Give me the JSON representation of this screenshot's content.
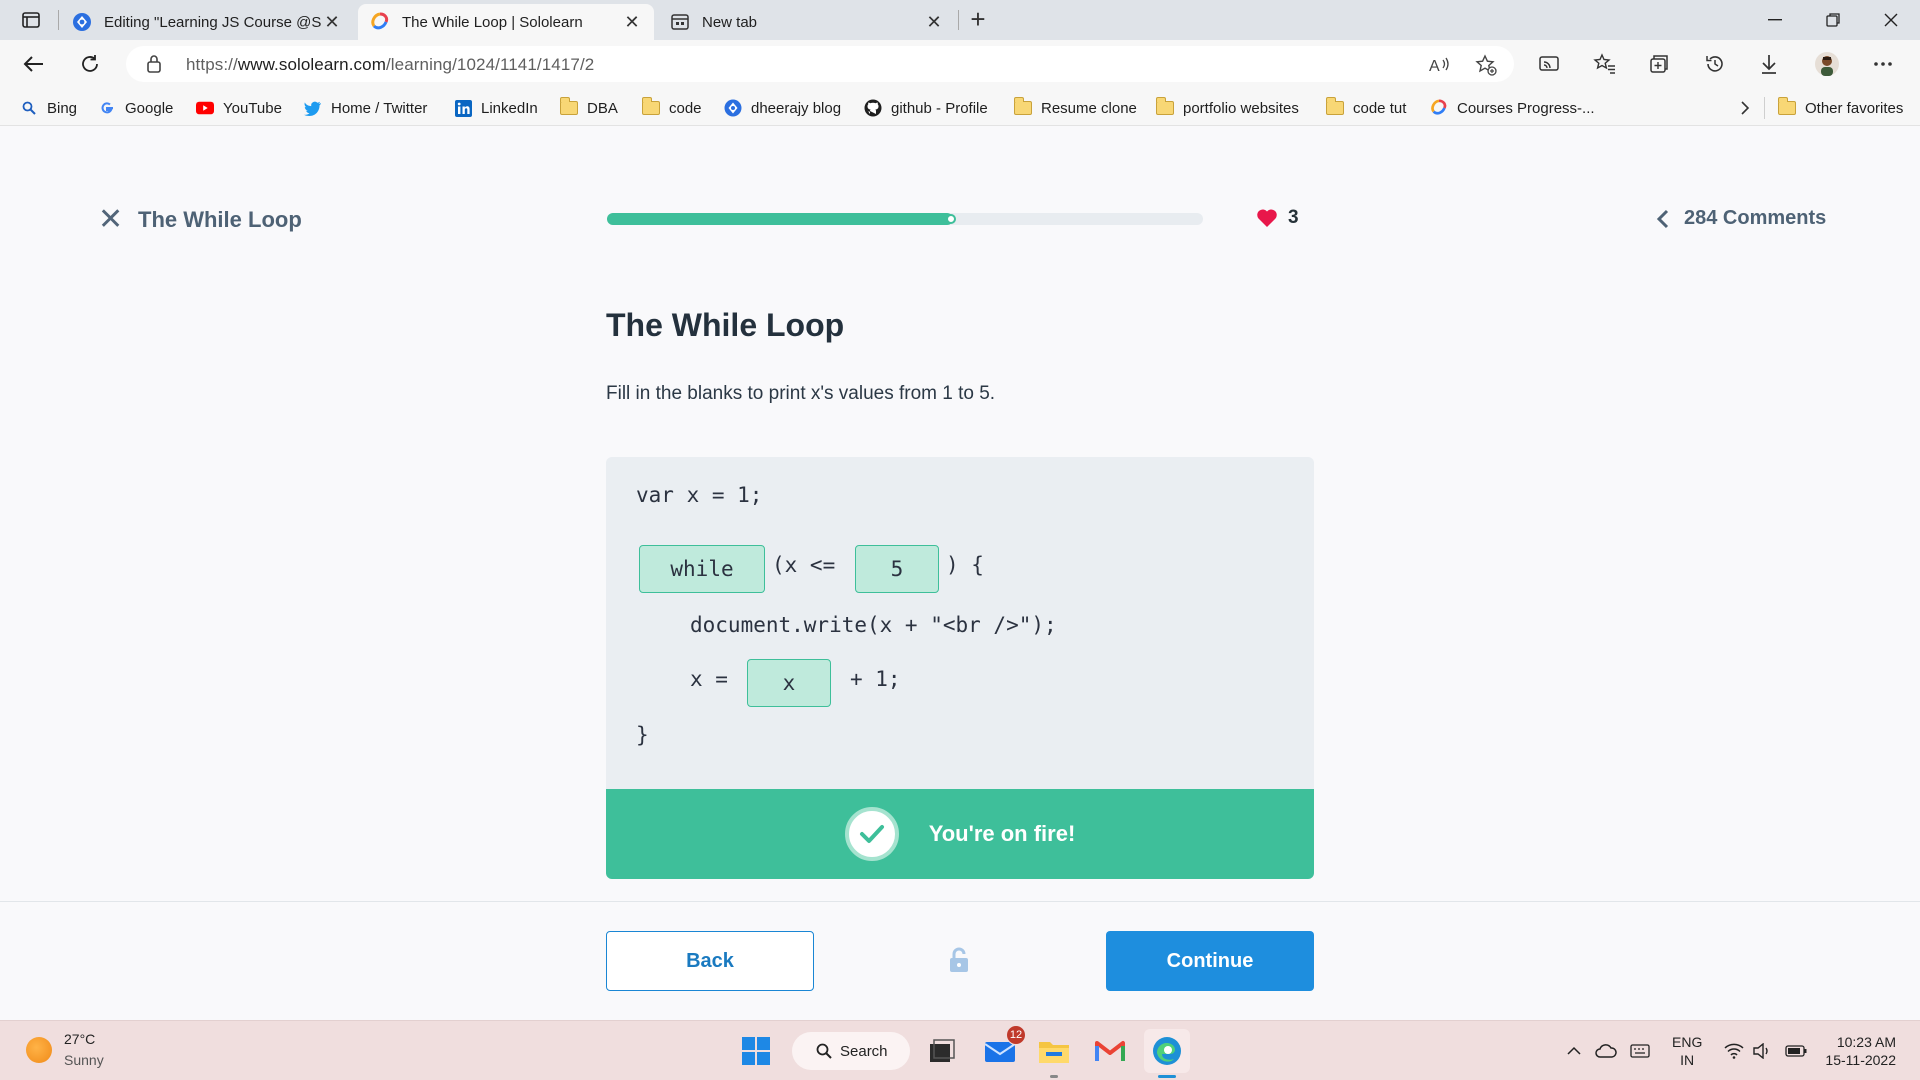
{
  "browser": {
    "tabs": [
      {
        "title": "Editing \"Learning JS Course @Sc",
        "active": false
      },
      {
        "title": "The While Loop | Sololearn",
        "active": true
      },
      {
        "title": "New tab",
        "active": false
      }
    ],
    "url_prefix": "https://",
    "url_host": "www.sololearn.com",
    "url_path": "/learning/1024/1141/1417/2",
    "favorites": [
      {
        "label": "Bing",
        "icon": "search-icon"
      },
      {
        "label": "Google",
        "icon": "google-icon"
      },
      {
        "label": "YouTube",
        "icon": "youtube-icon"
      },
      {
        "label": "Home / Twitter",
        "icon": "twitter-icon"
      },
      {
        "label": "LinkedIn",
        "icon": "linkedin-icon"
      },
      {
        "label": "DBA",
        "icon": "folder-icon"
      },
      {
        "label": "code",
        "icon": "folder-icon"
      },
      {
        "label": "dheerajy blog",
        "icon": "blog-icon"
      },
      {
        "label": "github - Profile",
        "icon": "github-icon"
      },
      {
        "label": "Resume clone",
        "icon": "folder-icon"
      },
      {
        "label": "portfolio websites",
        "icon": "folder-icon"
      },
      {
        "label": "code tut",
        "icon": "folder-icon"
      },
      {
        "label": "Courses Progress-...",
        "icon": "sololearn-icon"
      }
    ],
    "other_favorites": "Other favorites"
  },
  "lesson": {
    "top_title": "The While Loop",
    "progress_fraction": 0.58,
    "hearts": "3",
    "comments": "284 Comments",
    "heading": "The While Loop",
    "description": "Fill in the blanks to print x's values from 1 to 5.",
    "code": {
      "line1": "var x = 1;",
      "blank_keyword": "while",
      "cond_open": "(x <=",
      "blank_limit": "5",
      "cond_close": ") {",
      "line3": "document.write(x + \"<br />\");",
      "assign_prefix": "x =",
      "blank_var": "x",
      "assign_suffix": "+ 1;",
      "closing": "}"
    },
    "feedback": "You're on fire!",
    "back_label": "Back",
    "continue_label": "Continue"
  },
  "colors": {
    "accent_green": "#3ebf9a",
    "accent_blue": "#1e8ede",
    "heart_red": "#e8174a"
  },
  "taskbar": {
    "temperature": "27°C",
    "weather": "Sunny",
    "search_label": "Search",
    "mail_badge": "12",
    "lang_primary": "ENG",
    "lang_region": "IN",
    "time": "10:23 AM",
    "date": "15-11-2022"
  }
}
